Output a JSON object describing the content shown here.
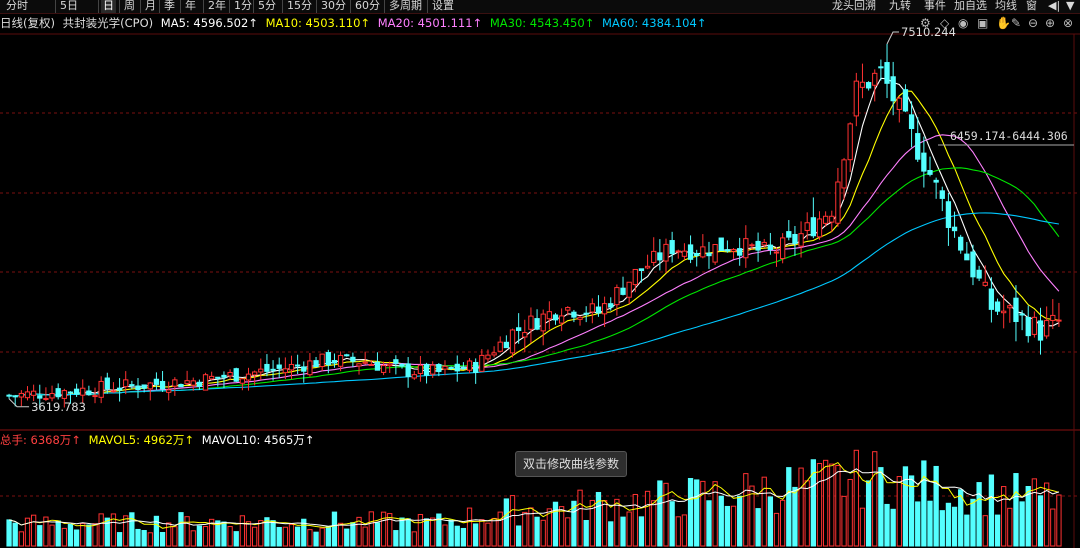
{
  "toolbar": {
    "left_items": [
      {
        "label": "分时",
        "active": false
      },
      {
        "label": "5日",
        "active": false
      },
      {
        "label": "日",
        "active": true
      },
      {
        "label": "周",
        "active": false
      },
      {
        "label": "月",
        "active": false
      },
      {
        "label": "季",
        "active": false
      },
      {
        "label": "年",
        "active": false
      },
      {
        "label": "2年",
        "active": false
      },
      {
        "label": "1分",
        "active": false
      },
      {
        "label": "5分",
        "active": false
      },
      {
        "label": "15分",
        "active": false
      },
      {
        "label": "30分",
        "active": false
      },
      {
        "label": "60分",
        "active": false
      },
      {
        "label": "多周期",
        "active": false
      },
      {
        "label": "设置",
        "active": false
      }
    ],
    "right_items": [
      "龙头回溯",
      "九转",
      "事件",
      "加自选",
      "均线",
      "窗"
    ]
  },
  "price_panel": {
    "period_label": "日线(复权)",
    "index_name": "共封装光学(CPO)",
    "ma5": "MA5: 4596.502↑",
    "ma10": "MA10: 4503.110↑",
    "ma20": "MA20: 4501.111↑",
    "ma30": "MA30: 4543.450↑",
    "ma60": "MA60: 4384.104↑",
    "high_label": "7510.244",
    "low_label": "3619.783",
    "range_label": "6459.174-6444.306"
  },
  "volume_panel": {
    "total": "总手: 6368万↑",
    "mavol5": "MAVOL5: 4962万↑",
    "mavol10": "MAVOL10: 4565万↑"
  },
  "tooltip": "双击修改曲线参数",
  "colors": {
    "up": "#ff3232",
    "down": "#54ffff",
    "ma5": "#ffffff",
    "ma10": "#ffff00",
    "ma20": "#ff80ff",
    "ma30": "#00e600",
    "ma60": "#00c8ff",
    "grid": "#7a1010"
  },
  "chart_data": {
    "type": "candlestick",
    "ylim": [
      3350,
      7900
    ],
    "price_key_points": [
      [
        0,
        3640
      ],
      [
        10,
        3700
      ],
      [
        20,
        3760
      ],
      [
        30,
        3820
      ],
      [
        38,
        3900
      ],
      [
        44,
        3960
      ],
      [
        52,
        4070
      ],
      [
        58,
        4050
      ],
      [
        64,
        3940
      ],
      [
        70,
        3920
      ],
      [
        76,
        4000
      ],
      [
        82,
        4400
      ],
      [
        90,
        4700
      ],
      [
        96,
        4640
      ],
      [
        102,
        5100
      ],
      [
        108,
        5420
      ],
      [
        112,
        5380
      ],
      [
        118,
        5450
      ],
      [
        124,
        5350
      ],
      [
        128,
        5500
      ],
      [
        134,
        5900
      ],
      [
        138,
        7300
      ],
      [
        142,
        7510
      ],
      [
        146,
        6900
      ],
      [
        150,
        6300
      ],
      [
        154,
        5600
      ],
      [
        160,
        4700
      ],
      [
        164,
        4600
      ],
      [
        168,
        4420
      ],
      [
        172,
        4560
      ]
    ],
    "candle_count": 172,
    "volume_key_points": [
      [
        0,
        1800
      ],
      [
        40,
        2000
      ],
      [
        70,
        1900
      ],
      [
        82,
        2900
      ],
      [
        100,
        3500
      ],
      [
        120,
        4400
      ],
      [
        135,
        5300
      ],
      [
        142,
        5600
      ],
      [
        150,
        4800
      ],
      [
        160,
        4300
      ],
      [
        172,
        3800
      ]
    ],
    "volume_max": 8000
  }
}
